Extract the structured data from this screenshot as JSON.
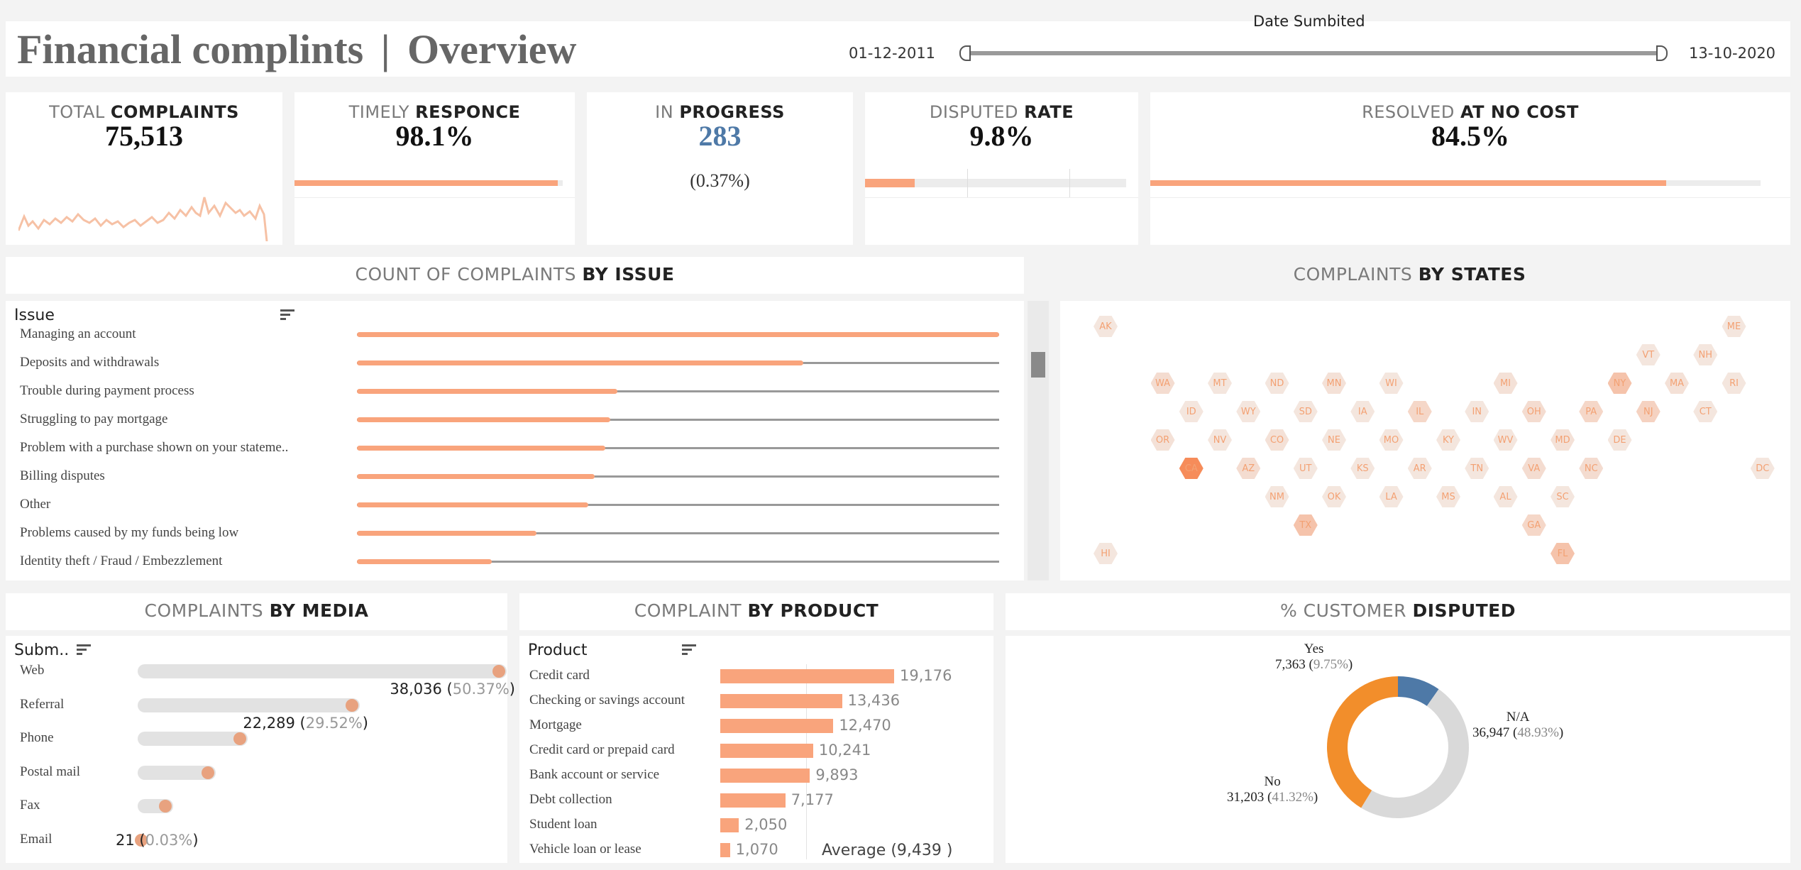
{
  "header": {
    "title": "Financial complints",
    "divider": "|",
    "subtitle": "Overview",
    "date_filter": {
      "label": "Date Sumbited",
      "start": "01-12-2011",
      "end": "13-10-2020"
    }
  },
  "kpis": {
    "total": {
      "title_light": "TOTAL",
      "title_dark": "COMPLAINTS",
      "value": "75,513"
    },
    "timely": {
      "title_light": "TIMELY",
      "title_dark": "RESPONCE",
      "value": "98.1%",
      "fill": 0.981
    },
    "in_progress": {
      "title_light": "IN",
      "title_dark": "PROGRESS",
      "value": "283",
      "sub": "(0.37%)"
    },
    "disputed": {
      "title_light": "DISPUTED",
      "title_dark": "RATE",
      "value": "9.8%",
      "fill": 0.19
    },
    "resolved": {
      "title_light": "RESOLVED",
      "title_dark": "AT NO COST",
      "value": "84.5%",
      "fill": 0.845
    }
  },
  "issues": {
    "title_light": "COUNT OF COMPLAINTS",
    "title_dark": "BY ISSUE",
    "header": "Issue",
    "items": [
      {
        "label": "Managing an account",
        "fill": 1.0
      },
      {
        "label": "Deposits and withdrawals",
        "fill": 0.695
      },
      {
        "label": "Trouble during payment process",
        "fill": 0.405
      },
      {
        "label": "Struggling to pay mortgage",
        "fill": 0.395
      },
      {
        "label": "Problem with a purchase shown on your stateme..",
        "fill": 0.387
      },
      {
        "label": "Billing disputes",
        "fill": 0.37
      },
      {
        "label": "Other",
        "fill": 0.36
      },
      {
        "label": "Problems caused by my funds being low",
        "fill": 0.28
      },
      {
        "label": "Identity theft / Fraud / Embezzlement",
        "fill": 0.21
      }
    ]
  },
  "states": {
    "title_light": "COMPLAINTS",
    "title_dark": "BY STATES",
    "items": [
      {
        "code": "AK",
        "col": 0,
        "row": 0,
        "intensity": 0.1
      },
      {
        "code": "ME",
        "col": 11,
        "row": 0,
        "intensity": 0.1
      },
      {
        "code": "VT",
        "col": 9.5,
        "row": 1,
        "intensity": 0.1
      },
      {
        "code": "NH",
        "col": 10.5,
        "row": 1,
        "intensity": 0.1
      },
      {
        "code": "WA",
        "col": 1,
        "row": 2,
        "intensity": 0.2
      },
      {
        "code": "MT",
        "col": 2,
        "row": 2,
        "intensity": 0.1
      },
      {
        "code": "ND",
        "col": 3,
        "row": 2,
        "intensity": 0.1
      },
      {
        "code": "MN",
        "col": 4,
        "row": 2,
        "intensity": 0.15
      },
      {
        "code": "WI",
        "col": 5,
        "row": 2,
        "intensity": 0.1
      },
      {
        "code": "MI",
        "col": 7,
        "row": 2,
        "intensity": 0.15
      },
      {
        "code": "NY",
        "col": 9,
        "row": 2,
        "intensity": 0.45
      },
      {
        "code": "MA",
        "col": 10,
        "row": 2,
        "intensity": 0.15
      },
      {
        "code": "RI",
        "col": 11,
        "row": 2,
        "intensity": 0.1
      },
      {
        "code": "ID",
        "col": 1.5,
        "row": 3,
        "intensity": 0.1
      },
      {
        "code": "WY",
        "col": 2.5,
        "row": 3,
        "intensity": 0.1
      },
      {
        "code": "SD",
        "col": 3.5,
        "row": 3,
        "intensity": 0.1
      },
      {
        "code": "IA",
        "col": 4.5,
        "row": 3,
        "intensity": 0.1
      },
      {
        "code": "IL",
        "col": 5.5,
        "row": 3,
        "intensity": 0.25
      },
      {
        "code": "IN",
        "col": 6.5,
        "row": 3,
        "intensity": 0.1
      },
      {
        "code": "OH",
        "col": 7.5,
        "row": 3,
        "intensity": 0.2
      },
      {
        "code": "PA",
        "col": 8.5,
        "row": 3,
        "intensity": 0.25
      },
      {
        "code": "NJ",
        "col": 9.5,
        "row": 3,
        "intensity": 0.3
      },
      {
        "code": "CT",
        "col": 10.5,
        "row": 3,
        "intensity": 0.1
      },
      {
        "code": "OR",
        "col": 1,
        "row": 4,
        "intensity": 0.15
      },
      {
        "code": "NV",
        "col": 2,
        "row": 4,
        "intensity": 0.1
      },
      {
        "code": "CO",
        "col": 3,
        "row": 4,
        "intensity": 0.15
      },
      {
        "code": "NE",
        "col": 4,
        "row": 4,
        "intensity": 0.1
      },
      {
        "code": "MO",
        "col": 5,
        "row": 4,
        "intensity": 0.1
      },
      {
        "code": "KY",
        "col": 6,
        "row": 4,
        "intensity": 0.1
      },
      {
        "code": "WV",
        "col": 7,
        "row": 4,
        "intensity": 0.1
      },
      {
        "code": "MD",
        "col": 8,
        "row": 4,
        "intensity": 0.15
      },
      {
        "code": "DE",
        "col": 9,
        "row": 4,
        "intensity": 0.1
      },
      {
        "code": "CA",
        "col": 1.5,
        "row": 5,
        "intensity": 1.0
      },
      {
        "code": "AZ",
        "col": 2.5,
        "row": 5,
        "intensity": 0.2
      },
      {
        "code": "UT",
        "col": 3.5,
        "row": 5,
        "intensity": 0.1
      },
      {
        "code": "KS",
        "col": 4.5,
        "row": 5,
        "intensity": 0.1
      },
      {
        "code": "AR",
        "col": 5.5,
        "row": 5,
        "intensity": 0.1
      },
      {
        "code": "TN",
        "col": 6.5,
        "row": 5,
        "intensity": 0.1
      },
      {
        "code": "VA",
        "col": 7.5,
        "row": 5,
        "intensity": 0.2
      },
      {
        "code": "NC",
        "col": 8.5,
        "row": 5,
        "intensity": 0.2
      },
      {
        "code": "DC",
        "col": 11.5,
        "row": 5,
        "intensity": 0.1
      },
      {
        "code": "NM",
        "col": 3,
        "row": 6,
        "intensity": 0.1
      },
      {
        "code": "OK",
        "col": 4,
        "row": 6,
        "intensity": 0.1
      },
      {
        "code": "LA",
        "col": 5,
        "row": 6,
        "intensity": 0.1
      },
      {
        "code": "MS",
        "col": 6,
        "row": 6,
        "intensity": 0.1
      },
      {
        "code": "AL",
        "col": 7,
        "row": 6,
        "intensity": 0.1
      },
      {
        "code": "SC",
        "col": 8,
        "row": 6,
        "intensity": 0.1
      },
      {
        "code": "TX",
        "col": 3.5,
        "row": 7,
        "intensity": 0.45
      },
      {
        "code": "GA",
        "col": 7.5,
        "row": 7,
        "intensity": 0.25
      },
      {
        "code": "HI",
        "col": 0,
        "row": 8,
        "intensity": 0.1
      },
      {
        "code": "FL",
        "col": 8,
        "row": 8,
        "intensity": 0.45
      }
    ]
  },
  "media": {
    "title_light": "COMPLAINTS",
    "title_dark": "BY MEDIA",
    "header": "Subm..",
    "items": [
      {
        "label": "Web",
        "fill": 1.0,
        "value": "38,036",
        "pct": "50.37%"
      },
      {
        "label": "Referral",
        "fill": 0.586,
        "value": "22,289",
        "pct": "29.52%"
      },
      {
        "label": "Phone",
        "fill": 0.27,
        "value": "",
        "pct": ""
      },
      {
        "label": "Postal mail",
        "fill": 0.18,
        "value": "",
        "pct": ""
      },
      {
        "label": "Fax",
        "fill": 0.06,
        "value": "",
        "pct": ""
      },
      {
        "label": "Email",
        "fill": 0.0,
        "value": "21",
        "pct": "0.03%"
      }
    ]
  },
  "product": {
    "title_light": "COMPLAINT",
    "title_dark": "BY PRODUCT",
    "header": "Product",
    "max": 19176,
    "average_label": "Average (9,439 )",
    "average": 9439,
    "items": [
      {
        "label": "Credit card",
        "value": 19176,
        "display": "19,176"
      },
      {
        "label": "Checking or savings account",
        "value": 13436,
        "display": "13,436"
      },
      {
        "label": "Mortgage",
        "value": 12470,
        "display": "12,470"
      },
      {
        "label": "Credit card or prepaid card",
        "value": 10241,
        "display": "10,241"
      },
      {
        "label": "Bank account or service",
        "value": 9893,
        "display": "9,893"
      },
      {
        "label": "Debt collection",
        "value": 7177,
        "display": "7,177"
      },
      {
        "label": "Student loan",
        "value": 2050,
        "display": "2,050"
      },
      {
        "label": "Vehicle loan or lease",
        "value": 1070,
        "display": "1,070"
      }
    ]
  },
  "disputed_chart": {
    "title_light": "% CUSTOMER",
    "title_dark": "DISPUTED",
    "segments": [
      {
        "label": "Yes",
        "value": "7,363",
        "pct": "9.75%",
        "fraction": 0.0975,
        "color": "#4e79a7"
      },
      {
        "label": "N/A",
        "value": "36,947",
        "pct": "48.93%",
        "fraction": 0.4893,
        "color": "#d9d9d9"
      },
      {
        "label": "No",
        "value": "31,203",
        "pct": "41.32%",
        "fraction": 0.4132,
        "color": "#f28e2b"
      }
    ]
  },
  "colors": {
    "accent": "#f9a47c",
    "blue": "#4e79a7",
    "orange": "#f28e2b"
  }
}
